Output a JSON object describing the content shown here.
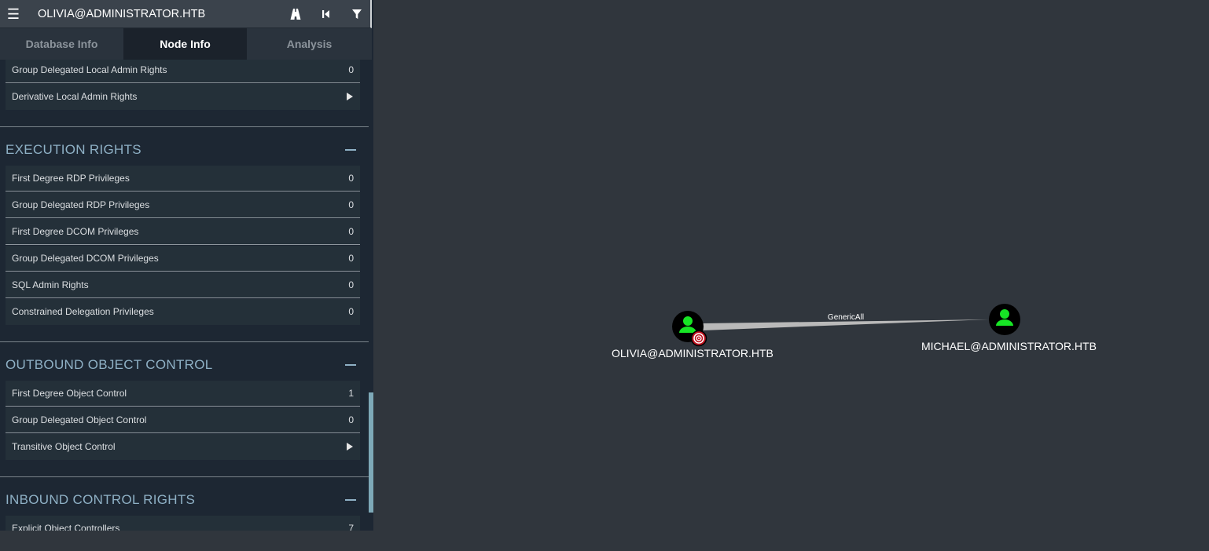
{
  "header": {
    "node_name": "OLIVIA@ADMINISTRATOR.HTB",
    "icons": [
      "menu-icon",
      "pathfinding-icon",
      "back-icon",
      "filter-icon"
    ]
  },
  "tabs": [
    {
      "label": "Database Info",
      "active": false
    },
    {
      "label": "Node Info",
      "active": true
    },
    {
      "label": "Analysis",
      "active": false
    }
  ],
  "local_admin": {
    "rows": [
      {
        "label": "Group Delegated Local Admin Rights",
        "value": "0"
      },
      {
        "label": "Derivative Local Admin Rights",
        "expand": true
      }
    ]
  },
  "execution_rights": {
    "title": "EXECUTION RIGHTS",
    "rows": [
      {
        "label": "First Degree RDP Privileges",
        "value": "0"
      },
      {
        "label": "Group Delegated RDP Privileges",
        "value": "0"
      },
      {
        "label": "First Degree DCOM Privileges",
        "value": "0"
      },
      {
        "label": "Group Delegated DCOM Privileges",
        "value": "0"
      },
      {
        "label": "SQL Admin Rights",
        "value": "0"
      },
      {
        "label": "Constrained Delegation Privileges",
        "value": "0"
      }
    ]
  },
  "outbound_control": {
    "title": "OUTBOUND OBJECT CONTROL",
    "rows": [
      {
        "label": "First Degree Object Control",
        "value": "1"
      },
      {
        "label": "Group Delegated Object Control",
        "value": "0"
      },
      {
        "label": "Transitive Object Control",
        "expand": true
      }
    ]
  },
  "inbound_control": {
    "title": "INBOUND CONTROL RIGHTS",
    "rows": [
      {
        "label": "Explicit Object Controllers",
        "value": "7"
      }
    ]
  },
  "graph": {
    "source": {
      "label": "OLIVIA@ADMINISTRATOR.HTB",
      "icon": "user-icon",
      "badge": "target-icon"
    },
    "target": {
      "label": "MICHAEL@ADMINISTRATOR.HTB",
      "icon": "user-icon"
    },
    "edge_label": "GenericAll",
    "colors": {
      "user_node": "#17e625",
      "node_bg": "#000000",
      "badge": "#c0121f",
      "edge": "#b9b9b9"
    }
  }
}
